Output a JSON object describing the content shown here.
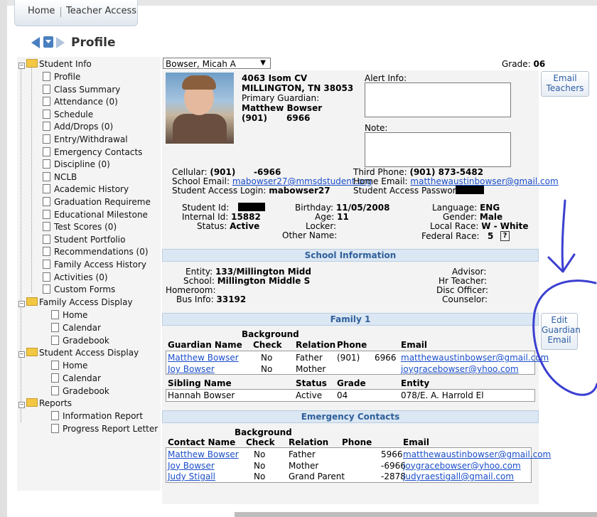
{
  "tabs": {
    "home": "Home",
    "teacher": "Teacher Access"
  },
  "page_title": "Profile",
  "tree": {
    "student_info": "Student Info",
    "items": [
      "Profile",
      "Class Summary",
      "Attendance (0)",
      "Schedule",
      "Add/Drops (0)",
      "Entry/Withdrawal",
      "Emergency Contacts",
      "Discipline (0)",
      "NCLB",
      "Academic History",
      "Graduation Requireme",
      "Educational Milestone",
      "Test Scores (0)",
      "Student Portfolio",
      "Recommendations (0)",
      "Family Access History",
      "Activities (0)",
      "Custom Forms"
    ],
    "family_access_display": "Family Access Display",
    "family_items": [
      "Home",
      "Calendar",
      "Gradebook"
    ],
    "student_access_display": "Student Access Display",
    "student_items": [
      "Home",
      "Calendar",
      "Gradebook"
    ],
    "reports": "Reports",
    "report_items": [
      "Information Report",
      "Progress Report Letter"
    ]
  },
  "student": {
    "select_value": "Bowser, Micah A",
    "grade_label": "Grade:",
    "grade_value": "06",
    "address1": "4063 Isom CV",
    "address2": "MILLINGTON, TN 38053",
    "primary_guardian_label": "Primary Guardian:",
    "primary_guardian": "Matthew Bowser",
    "guardian_phone_a": "(901)",
    "guardian_phone_b": "6966",
    "alert_label": "Alert Info:",
    "note_label": "Note:",
    "cellular_label": "Cellular:",
    "cellular_a": "(901)",
    "cellular_b": "-6966",
    "school_email_label": "School Email:",
    "school_email": "mabowser27@mmsdstudent.org",
    "login_label": "Student Access Login:",
    "login": "mabowser27",
    "third_phone_label": "Third Phone:",
    "third_phone": "(901) 873-5482",
    "home_email_label": "Home Email:",
    "home_email": "matthewaustinbowser@gmail.com",
    "password_label": "Student Access Password:",
    "student_id_label": "Student Id:",
    "internal_id_label": "Internal Id:",
    "internal_id": "15882",
    "status_label": "Status:",
    "status": "Active",
    "birthday_label": "Birthday:",
    "birthday": "11/05/2008",
    "age_label": "Age:",
    "age": "11",
    "locker_label": "Locker:",
    "other_name_label": "Other Name:",
    "language_label": "Language:",
    "language": "ENG",
    "gender_label": "Gender:",
    "gender": "Male",
    "local_race_label": "Local Race:",
    "local_race": "W - White",
    "federal_race_label": "Federal Race:",
    "federal_race": "5",
    "help": "?"
  },
  "school": {
    "header": "School Information",
    "entity_label": "Entity:",
    "entity": "133/Millington Midd",
    "school_label": "School:",
    "school": "Millington Middle S",
    "homeroom_label": "Homeroom:",
    "bus_label": "Bus Info:",
    "bus": "33192",
    "advisor_label": "Advisor:",
    "hr_teacher_label": "Hr Teacher:",
    "disc_officer_label": "Disc Officer:",
    "counselor_label": "Counselor:"
  },
  "family": {
    "header": "Family 1",
    "cols": {
      "guardian": "Guardian Name",
      "background1": "Background",
      "background2": "Check",
      "relation": "Relation",
      "phone": "Phone",
      "email": "Email"
    },
    "guardians": [
      {
        "name": "Matthew Bowser",
        "check": "No",
        "relation": "Father",
        "phone_a": "(901)",
        "phone_b": "6966",
        "email": "matthewaustinbowser@gmail.com"
      },
      {
        "name": "Joy Bowser",
        "check": "No",
        "relation": "Mother",
        "phone_a": "",
        "phone_b": "",
        "email": "joygracebowser@yhoo.com"
      }
    ],
    "sib_cols": {
      "name": "Sibling Name",
      "status": "Status",
      "grade": "Grade",
      "entity": "Entity"
    },
    "siblings": [
      {
        "name": "Hannah Bowser",
        "status": "Active",
        "grade": "04",
        "entity": "078/E. A. Harrold El"
      }
    ]
  },
  "emergency": {
    "header": "Emergency Contacts",
    "cols": {
      "contact": "Contact Name",
      "background1": "Background",
      "background2": "Check",
      "relation": "Relation",
      "phone": "Phone",
      "email": "Email"
    },
    "contacts": [
      {
        "name": "Matthew Bowser",
        "check": "No",
        "relation": "Father",
        "phone": "5966",
        "email": "matthewaustinbowser@gmail.com"
      },
      {
        "name": "Joy Bowser",
        "check": "No",
        "relation": "Mother",
        "phone": "-6966",
        "email": "joygracebowser@yhoo.com"
      },
      {
        "name": "Judy Stigall",
        "check": "No",
        "relation": "Grand Parent",
        "phone": "-2878",
        "email": "judyraestigall@gmail.com"
      }
    ]
  },
  "buttons": {
    "email_teachers_1": "Email",
    "email_teachers_2": "Teachers",
    "edit_1": "Edit",
    "edit_2": "Guardian",
    "edit_3": "Email"
  },
  "annotation_color": "#3b3fd1"
}
